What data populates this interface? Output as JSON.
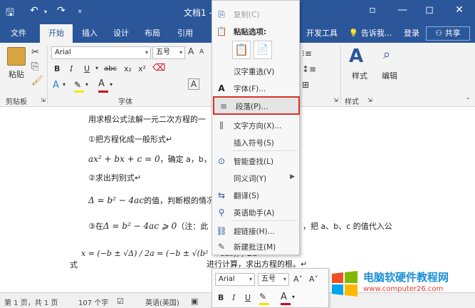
{
  "titlebar": {
    "title": "文档1 - W",
    "restore_symbol": "◻",
    "close_symbol": "✕",
    "minimize_symbol": "—",
    "menu_symbol": "▫"
  },
  "tabs": [
    "文件",
    "开始",
    "插入",
    "设计",
    "布局",
    "引用",
    "开发工具"
  ],
  "tell_me": "告诉我...",
  "login": "登录",
  "share": "共享",
  "ribbon": {
    "paste_label": "粘贴",
    "clipboard_label": "剪贴板",
    "font_name": "Arial",
    "font_size": "五号",
    "font_group_label": "字体",
    "style_label": "样式",
    "edit_label": "编辑",
    "style_group_label": "样式",
    "b": "B",
    "i": "I",
    "u": "U",
    "strike": "abc",
    "sub": "x₂",
    "sup": "x²",
    "a_big": "A",
    "a_small": "A",
    "font_glyph": "A",
    "text_effect": "A"
  },
  "document": {
    "line1": "用求根公式法解一元二次方程的一",
    "line2": "①把方程化成一般形式↵",
    "line3_math": "ax² + bx + c = 0",
    "line3_text": "，确定 a，b，",
    "line4": "②求出判别式↵",
    "line5_math": "Δ = b² − 4ac",
    "line5_text": "的值，判断根的情况",
    "line6_prefix": "③在",
    "line6_math": "Δ = b² − 4ac ⩾ 0",
    "line6_text": "（注：此",
    "line6_right": "，把 a、b、c 的值代入公",
    "line7_prefix": "式",
    "line7_math_1": "x = (−b ± √Δ) / 2a = (−b ± √(b² − 4ac)) / 2a",
    "line7_text": "进行计算，求出方程的根。↵"
  },
  "context_menu": {
    "items": [
      {
        "label": "复制(C)",
        "icon": "copy-icon",
        "glyph": "⎘",
        "disabled": true
      },
      {
        "label": "粘贴选项:",
        "icon": "paste-icon",
        "glyph": "📋",
        "disabled": false,
        "bold": true
      },
      {
        "label": "汉字重选(V)",
        "icon": "",
        "glyph": "",
        "disabled": false
      },
      {
        "label": "字体(F)...",
        "icon": "font-icon",
        "glyph": "A",
        "disabled": false
      },
      {
        "label": "段落(P)...",
        "icon": "paragraph-icon",
        "glyph": "≡",
        "disabled": false,
        "highlight": true
      },
      {
        "label": "文字方向(X)...",
        "icon": "text-direction-icon",
        "glyph": "⫼",
        "disabled": false
      },
      {
        "label": "插入符号(S)",
        "icon": "",
        "glyph": "",
        "disabled": false
      },
      {
        "label": "智能查找(L)",
        "icon": "smart-lookup-icon",
        "glyph": "⊙",
        "disabled": false
      },
      {
        "label": "同义词(Y)",
        "icon": "",
        "glyph": "",
        "disabled": false,
        "submenu": "▶"
      },
      {
        "label": "翻译(S)",
        "icon": "translate-icon",
        "glyph": "⇆",
        "disabled": false
      },
      {
        "label": "英语助手(A)",
        "icon": "english-assistant-icon",
        "glyph": "⚲",
        "disabled": false
      },
      {
        "label": "超链接(H)...",
        "icon": "hyperlink-icon",
        "glyph": "⛓",
        "disabled": false
      },
      {
        "label": "新建批注(M)",
        "icon": "new-comment-icon",
        "glyph": "✎",
        "disabled": false
      }
    ]
  },
  "mini_toolbar": {
    "font": "Arial",
    "size": "五号",
    "grow": "A˄",
    "shrink": "A˅",
    "b": "B",
    "i": "I",
    "u": "U"
  },
  "status": {
    "page": "第 1 页，共 1 页",
    "words": "107 个字",
    "lang": "英语(美国)"
  },
  "watermark": {
    "title": "电脑软硬件教程网",
    "url": "www.computer26.com"
  },
  "colors": {
    "accent": "#2b579a",
    "highlight_border": "#d9312b",
    "highlight_yellow": "#f5e400",
    "font_red": "#d0021b"
  }
}
